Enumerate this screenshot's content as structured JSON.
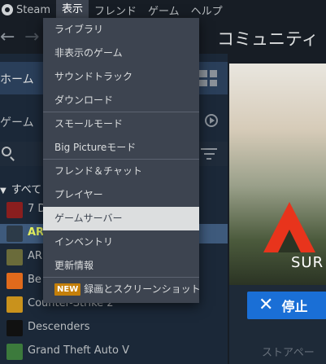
{
  "menubar": {
    "items": [
      "Steam",
      "表示",
      "フレンド",
      "ゲーム",
      "ヘルプ"
    ],
    "active_index": 1
  },
  "navbar": {
    "back_glyph": "←",
    "forward_glyph": "→",
    "section": "コミュニティ"
  },
  "sidebar": {
    "home_label": "ホーム",
    "games_label": "ゲーム",
    "all_label": "すべて",
    "games": [
      {
        "name": "7 D",
        "icon_color": "#8a1e1e",
        "selected": false
      },
      {
        "name": "AR",
        "icon_color": "#2c3a48",
        "selected": true
      },
      {
        "name": "AR",
        "icon_color": "#6a6b3a",
        "selected": false
      },
      {
        "name": "Be",
        "icon_color": "#e06a1c",
        "selected": false
      },
      {
        "name": "Counter-Strike 2",
        "icon_color": "#c9921c",
        "selected": false
      },
      {
        "name": "Descenders",
        "icon_color": "#111111",
        "selected": false
      },
      {
        "name": "Grand Theft Auto V",
        "icon_color": "#3c7a3c",
        "selected": false
      }
    ]
  },
  "main": {
    "hero_text": "SUR",
    "stop_button": "停止",
    "store_tab": "ストアペー"
  },
  "dropdown": {
    "items": [
      {
        "label": "ライブラリ",
        "hover": false,
        "badge": ""
      },
      {
        "label": "非表示のゲーム",
        "hover": false,
        "badge": ""
      },
      {
        "label": "サウンドトラック",
        "hover": false,
        "badge": ""
      },
      {
        "label": "ダウンロード",
        "hover": false,
        "badge": ""
      },
      {
        "label": "スモールモード",
        "hover": false,
        "badge": ""
      },
      {
        "label": "Big Pictureモード",
        "hover": false,
        "badge": ""
      },
      {
        "label": "フレンド＆チャット",
        "hover": false,
        "badge": ""
      },
      {
        "label": "プレイヤー",
        "hover": false,
        "badge": ""
      },
      {
        "label": "ゲームサーバー",
        "hover": true,
        "badge": ""
      },
      {
        "label": "インベントリ",
        "hover": false,
        "badge": ""
      },
      {
        "label": "更新情報",
        "hover": false,
        "badge": ""
      },
      {
        "label": "録画とスクリーンショット",
        "hover": false,
        "badge": "NEW"
      }
    ]
  },
  "colors": {
    "accent_blue": "#1a6fd6",
    "selected_game_text": "#e6f260",
    "new_badge": "#c47f0a"
  }
}
